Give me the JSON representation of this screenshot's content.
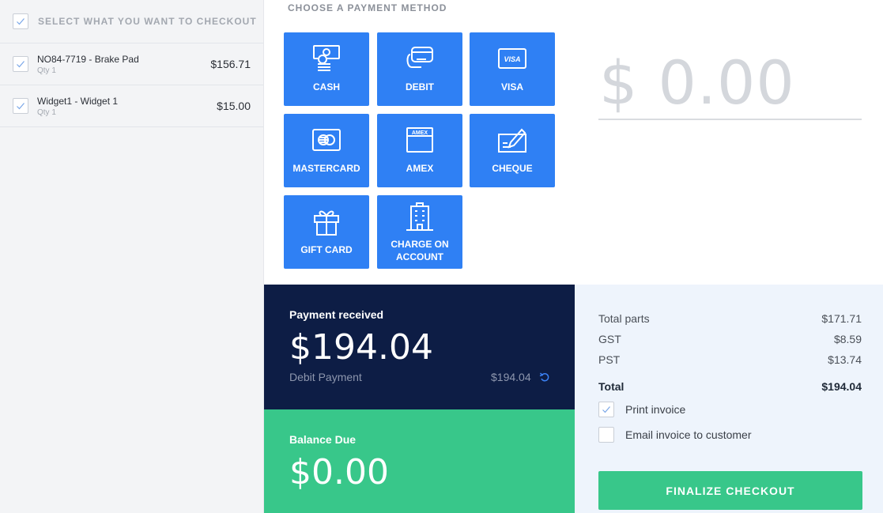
{
  "cart": {
    "select_all_label": "SELECT WHAT YOU WANT TO CHECKOUT",
    "items": [
      {
        "name": "NO84-7719 - Brake Pad",
        "qty": "Qty 1",
        "price": "$156.71"
      },
      {
        "name": "Widget1 - Widget 1",
        "qty": "Qty 1",
        "price": "$15.00"
      }
    ]
  },
  "payment": {
    "title": "CHOOSE A PAYMENT METHOD",
    "methods": [
      {
        "label": "CASH",
        "icon": "cash-icon"
      },
      {
        "label": "DEBIT",
        "icon": "debit-card-icon"
      },
      {
        "label": "VISA",
        "icon": "visa-icon"
      },
      {
        "label": "MASTERCARD",
        "icon": "mastercard-icon"
      },
      {
        "label": "AMEX",
        "icon": "amex-icon"
      },
      {
        "label": "CHEQUE",
        "icon": "cheque-icon"
      },
      {
        "label": "GIFT CARD",
        "icon": "gift-icon"
      },
      {
        "label": "CHARGE ON ACCOUNT",
        "label_line1": "CHARGE ON",
        "label_line2": "ACCOUNT",
        "icon": "building-icon"
      }
    ],
    "visa_badge": "VISA",
    "amex_badge": "AMEX",
    "amount": "$ 0.00"
  },
  "received": {
    "title": "Payment received",
    "amount": "$194.04",
    "line_label": "Debit Payment",
    "line_amount": "$194.04",
    "undo_icon": "undo-icon"
  },
  "balance": {
    "title": "Balance Due",
    "amount": "$0.00"
  },
  "summary": {
    "rows": [
      {
        "label": "Total parts",
        "value": "$171.71"
      },
      {
        "label": "GST",
        "value": "$8.59"
      },
      {
        "label": "PST",
        "value": "$13.74"
      }
    ],
    "total_label": "Total",
    "total_value": "$194.04",
    "print_invoice": {
      "label": "Print invoice",
      "checked": true
    },
    "email_invoice": {
      "label": "Email invoice to customer",
      "checked": false
    },
    "finalize_label": "FINALIZE CHECKOUT"
  },
  "colors": {
    "primary_blue": "#2f80f4",
    "navy": "#0d1d45",
    "green": "#38c78a",
    "summary_bg": "#eef4fc"
  }
}
